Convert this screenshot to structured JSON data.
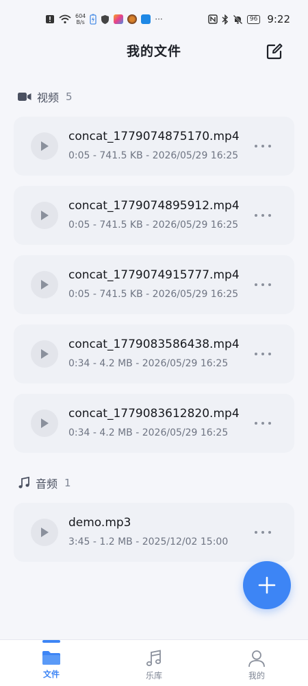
{
  "status_bar": {
    "net_speed_value": "604",
    "net_speed_unit": "B/s",
    "more_indicator": "···",
    "battery": "96",
    "time": "9:22"
  },
  "header": {
    "title": "我的文件"
  },
  "sections": {
    "video": {
      "title": "视频",
      "count": "5"
    },
    "audio": {
      "title": "音频",
      "count": "1"
    }
  },
  "files": [
    {
      "name": "concat_1779074875170.mp4",
      "meta": "0:05 - 741.5 KB - 2026/05/29 16:25"
    },
    {
      "name": "concat_1779074895912.mp4",
      "meta": "0:05 - 741.5 KB - 2026/05/29 16:25"
    },
    {
      "name": "concat_1779074915777.mp4",
      "meta": "0:05 - 741.5 KB - 2026/05/29 16:25"
    },
    {
      "name": "concat_1779083586438.mp4",
      "meta": "0:34 - 4.2 MB - 2026/05/29 16:25"
    },
    {
      "name": "concat_1779083612820.mp4",
      "meta": "0:34 - 4.2 MB - 2026/05/29 16:25"
    },
    {
      "name": "demo.mp3",
      "meta": "3:45 - 1.2 MB - 2025/12/02 15:00"
    }
  ],
  "nav": {
    "files": "文件",
    "library": "乐库",
    "mine": "我的"
  },
  "colors": {
    "accent": "#3d85f5",
    "background": "#f5f6fa",
    "card": "#eff1f6"
  }
}
